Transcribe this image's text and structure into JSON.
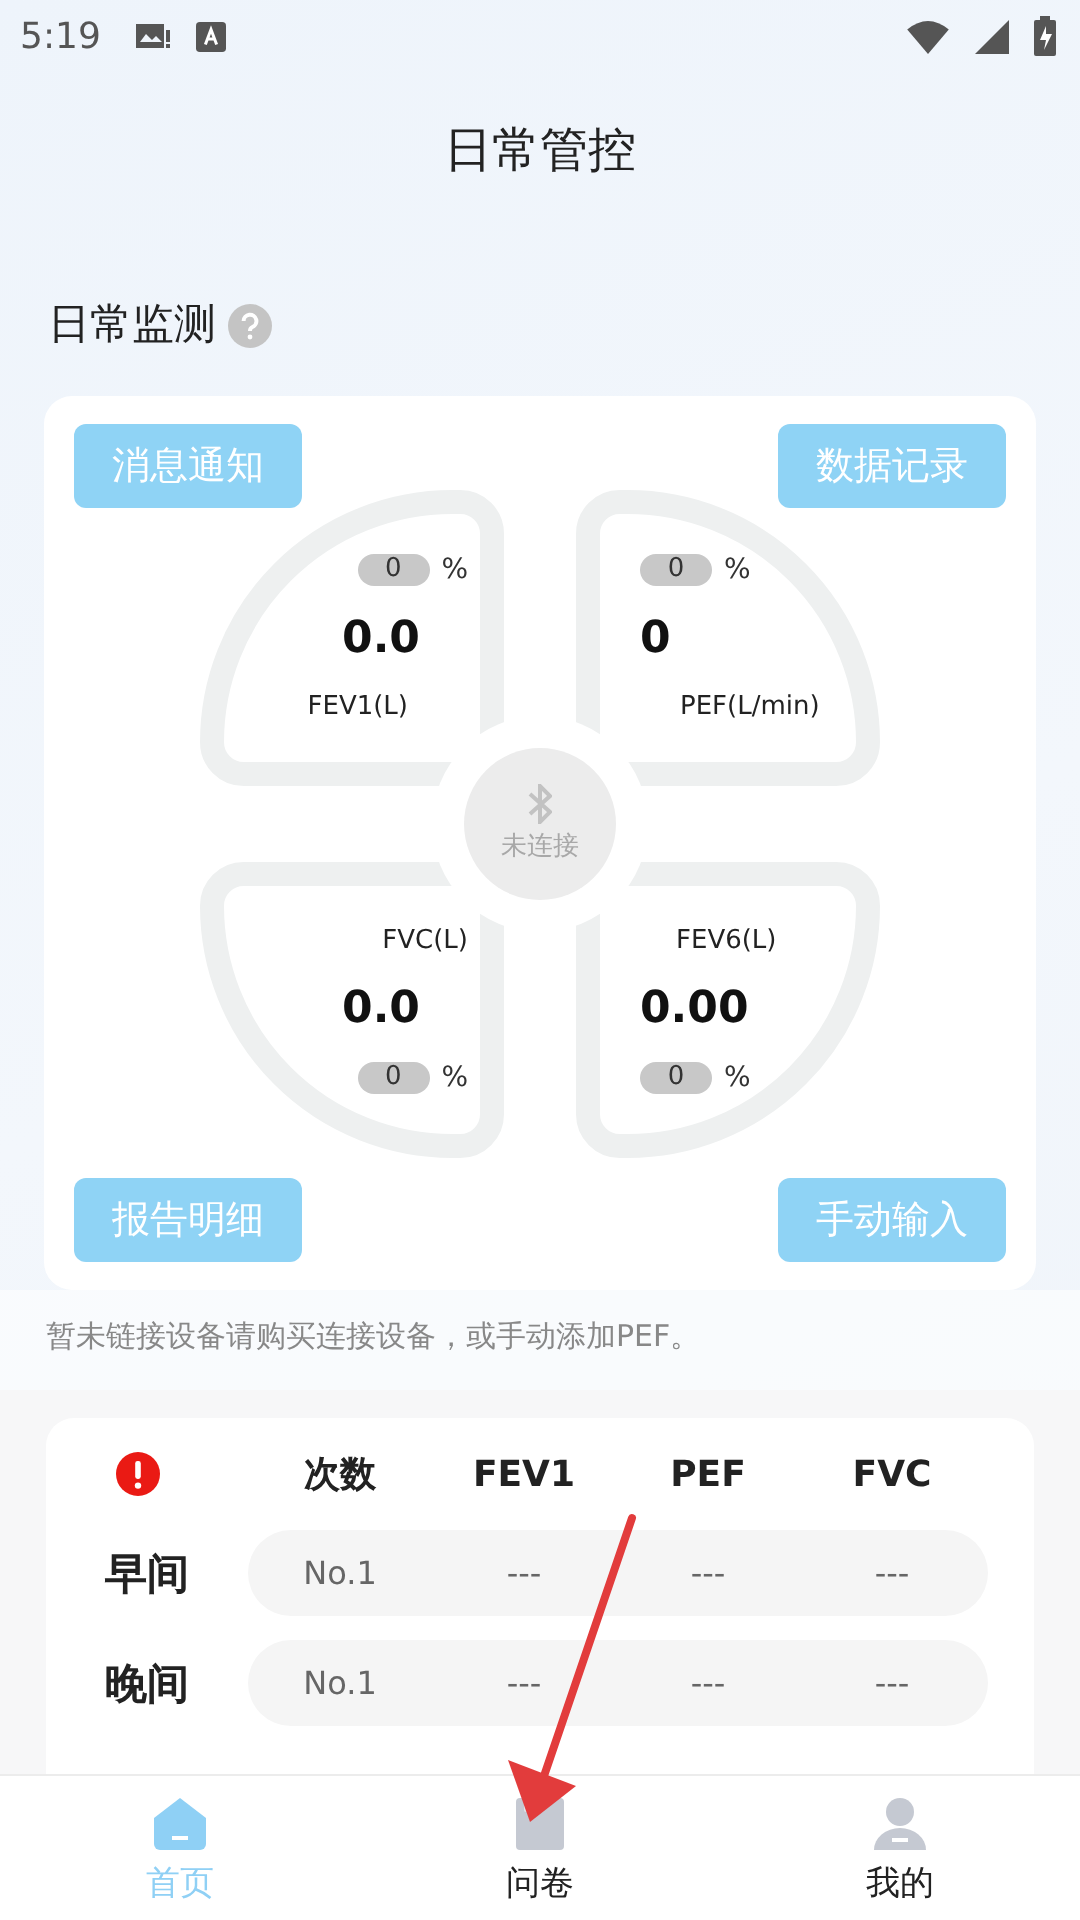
{
  "status_bar": {
    "time": "5:19"
  },
  "header": {
    "title": "日常管控"
  },
  "monitor": {
    "title": "日常监测",
    "buttons": [
      {
        "label": "消息通知"
      },
      {
        "label": "数据记录"
      },
      {
        "label": "报告明细"
      },
      {
        "label": "手动输入"
      }
    ],
    "metrics": [
      {
        "label": "FEV1(L)",
        "value": "0.0",
        "percent": "0",
        "unit": "%"
      },
      {
        "label": "PEF(L/min)",
        "value": "0",
        "percent": "0",
        "unit": "%"
      },
      {
        "label": "FVC(L)",
        "value": "0.0",
        "percent": "0",
        "unit": "%"
      },
      {
        "label": "FEV6(L)",
        "value": "0.00",
        "percent": "0",
        "unit": "%"
      }
    ],
    "connection": "未连接"
  },
  "hint": "暂未链接设备请购买连接设备，或手动添加PEF。",
  "table": {
    "columns": [
      "次数",
      "FEV1",
      "PEF",
      "FVC"
    ],
    "rows": [
      {
        "label": "早间",
        "cells": [
          "No.1",
          "---",
          "---",
          "---"
        ]
      },
      {
        "label": "晚间",
        "cells": [
          "No.1",
          "---",
          "---",
          "---"
        ]
      }
    ]
  },
  "tab_bar": [
    {
      "label": "首页",
      "selected": true
    },
    {
      "label": "问卷",
      "selected": false
    },
    {
      "label": "我的",
      "selected": false
    }
  ]
}
